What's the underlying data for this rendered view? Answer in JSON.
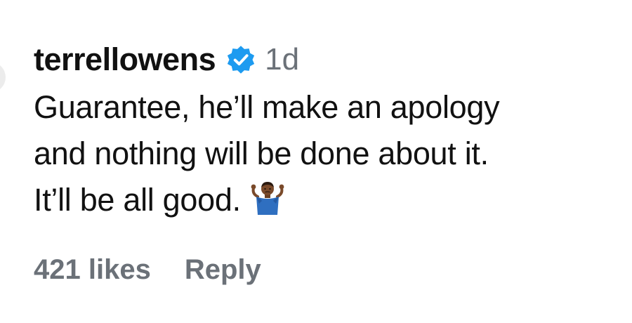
{
  "comment": {
    "username": "terrellowens",
    "verified_icon": "verified-badge-icon",
    "time": "1d",
    "lines": [
      "Guarantee, he’ll make an apology",
      "and nothing will be done about it.",
      "It’ll be all good."
    ],
    "emoji_icon": "person-shrugging-emoji"
  },
  "actions": {
    "likes": "421 likes",
    "reply": "Reply"
  },
  "colors": {
    "text": "#111111",
    "muted": "#6b7178",
    "verified_blue": "#1d9bf0"
  }
}
